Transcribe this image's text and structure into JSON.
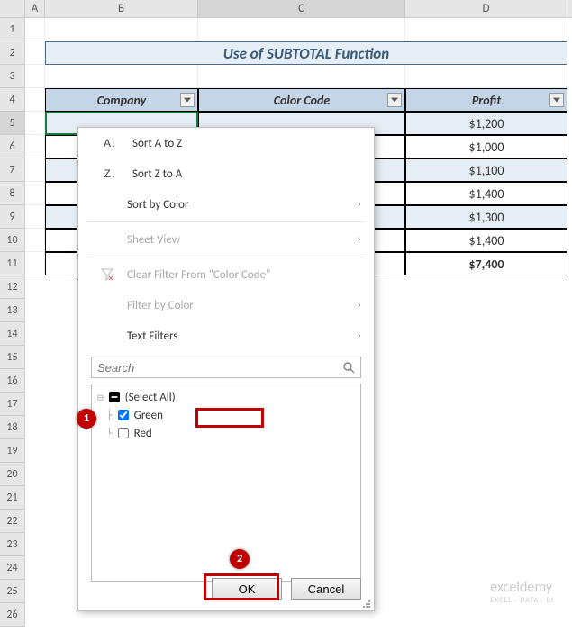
{
  "columns": [
    "A",
    "B",
    "C",
    "D"
  ],
  "rows": [
    "1",
    "2",
    "3",
    "4",
    "5",
    "6",
    "7",
    "8",
    "9",
    "10",
    "11",
    "12",
    "13",
    "14",
    "15",
    "16",
    "17",
    "18",
    "19",
    "20",
    "21",
    "22",
    "23",
    "24",
    "25",
    "26"
  ],
  "title": "Use of SUBTOTAL Function",
  "headers": {
    "b": "Company",
    "c": "Color Code",
    "d": "Profit"
  },
  "profits": [
    "$1,200",
    "$1,000",
    "$1,100",
    "$1,400",
    "$1,300",
    "$1,400",
    "$7,400"
  ],
  "menu": {
    "sort_az": "Sort A to Z",
    "sort_za": "Sort Z to A",
    "sort_color": "Sort by Color",
    "sheet_view": "Sheet View",
    "clear_filter": "Clear Filter From \"Color Code\"",
    "filter_color": "Filter by Color",
    "text_filters": "Text Filters",
    "search_placeholder": "Search",
    "select_all": "(Select All)",
    "opt_green": "Green",
    "opt_red": "Red",
    "ok": "OK",
    "cancel": "Cancel"
  },
  "callouts": {
    "c1": "1",
    "c2": "2"
  },
  "watermark": {
    "main": "exceldemy",
    "sub": "EXCEL · DATA · BI"
  }
}
